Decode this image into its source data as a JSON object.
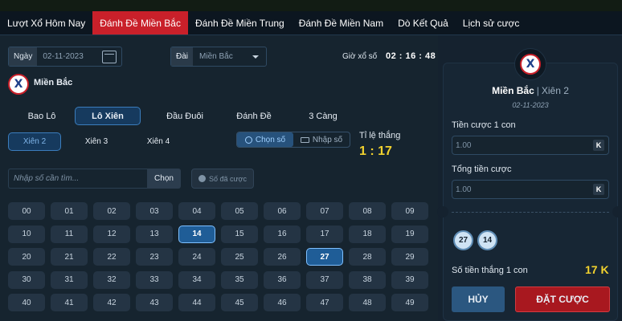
{
  "nav": {
    "tabs": [
      {
        "label": "Lượt Xổ Hôm Nay",
        "active": false
      },
      {
        "label": "Đánh Đề Miền Bắc",
        "active": true
      },
      {
        "label": "Đánh Đề Miền Trung",
        "active": false
      },
      {
        "label": "Đánh Đề Miền Nam",
        "active": false
      },
      {
        "label": "Dò Kết Quả",
        "active": false
      },
      {
        "label": "Lịch sử cược",
        "active": false
      }
    ]
  },
  "filters": {
    "date_label": "Ngày",
    "date_value": "02-11-2023",
    "dai_label": "Đài",
    "dai_value": "Miền Bắc",
    "draw_time_label": "Giờ xổ số",
    "draw_time": "02 : 16 : 48"
  },
  "region": {
    "name": "Miền Bắc",
    "logo_letter": "X"
  },
  "bet_types": [
    {
      "label": "Bao Lô",
      "active": false
    },
    {
      "label": "Lô Xiên",
      "active": true
    },
    {
      "label": "Đầu Đuôi",
      "active": false
    },
    {
      "label": "Đánh Đề",
      "active": false
    },
    {
      "label": "3 Càng",
      "active": false
    }
  ],
  "sub_types": [
    {
      "label": "Xiên 2",
      "active": true
    },
    {
      "label": "Xiên 3",
      "active": false
    },
    {
      "label": "Xiên 4",
      "active": false
    }
  ],
  "modes": {
    "choose": "Chọn số",
    "enter": "Nhập số",
    "active": "choose"
  },
  "ratio": {
    "label": "Tỉ lệ thắng",
    "value": "1 : 17"
  },
  "search": {
    "placeholder": "Nhập số cần tìm...",
    "button": "Chọn",
    "bet_numbers": "Số đã cược"
  },
  "numbers": [
    "00",
    "01",
    "02",
    "03",
    "04",
    "05",
    "06",
    "07",
    "08",
    "09",
    "10",
    "11",
    "12",
    "13",
    "14",
    "15",
    "16",
    "17",
    "18",
    "19",
    "20",
    "21",
    "22",
    "23",
    "24",
    "25",
    "26",
    "27",
    "28",
    "29",
    "30",
    "31",
    "32",
    "33",
    "34",
    "35",
    "36",
    "37",
    "38",
    "39",
    "40",
    "41",
    "42",
    "43",
    "44",
    "45",
    "46",
    "47",
    "48",
    "49"
  ],
  "selected_numbers": [
    "14",
    "27"
  ],
  "ticket": {
    "region": "Miền Bắc",
    "kind": "Xiên 2",
    "date": "02-11-2023",
    "stake_label": "Tiền cược 1 con",
    "stake_value": "1.00",
    "total_label": "Tổng tiền cược",
    "total_value": "1.00",
    "unit": "K",
    "picked": [
      "27",
      "14"
    ],
    "win_label": "Số tiền thắng 1 con",
    "win_value": "17 K",
    "cancel": "HỦY",
    "submit": "ĐẶT CƯỢC"
  },
  "colors": {
    "accent_red": "#c9202a",
    "highlight_yellow": "#f2d22e",
    "selected_blue": "#1f5d97"
  }
}
